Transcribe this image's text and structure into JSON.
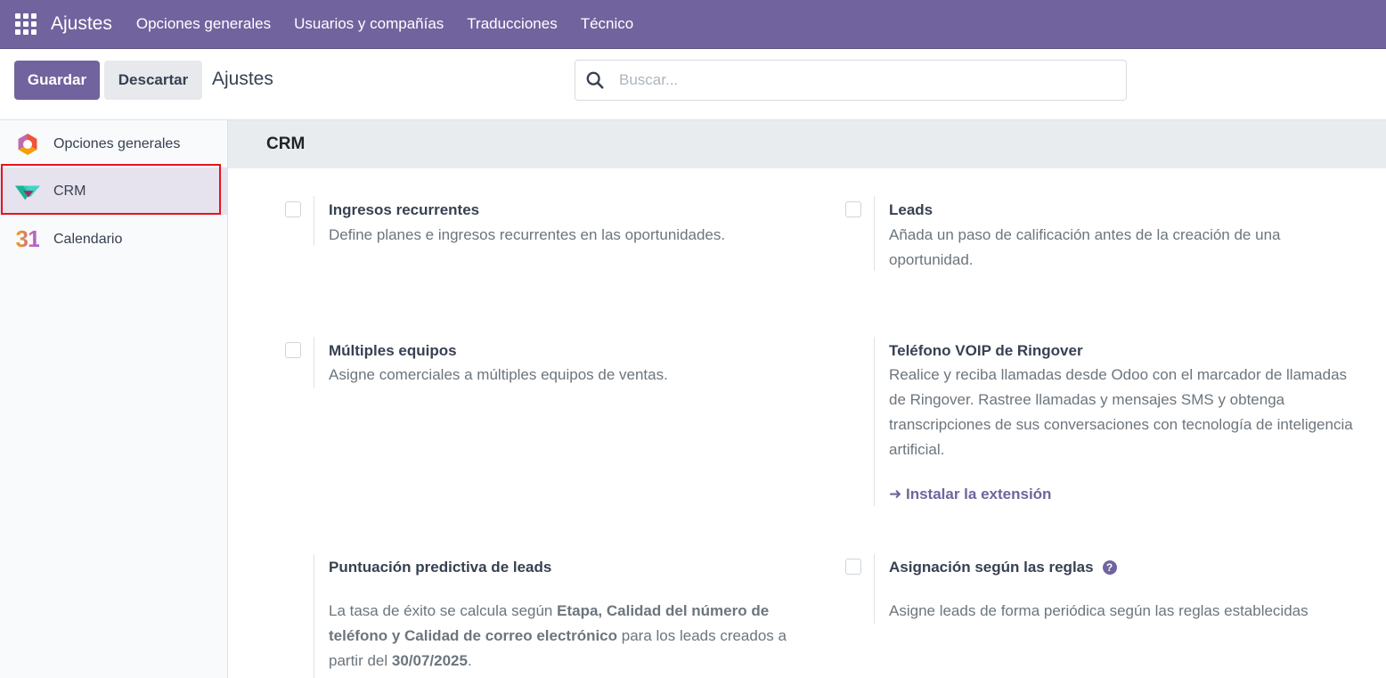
{
  "navbar": {
    "brand": "Ajustes",
    "menu": [
      "Opciones generales",
      "Usuarios y compañías",
      "Traducciones",
      "Técnico"
    ],
    "color": "#71639e"
  },
  "control_panel": {
    "save_label": "Guardar",
    "discard_label": "Descartar",
    "title": "Ajustes",
    "search_placeholder": "Buscar..."
  },
  "sidebar": {
    "items": [
      {
        "label": "Opciones generales",
        "icon": "general-settings-icon"
      },
      {
        "label": "CRM",
        "icon": "crm-icon",
        "active": true
      },
      {
        "label": "Calendario",
        "icon": "calendar-icon",
        "icon_text": "31"
      }
    ]
  },
  "section": {
    "title": "CRM",
    "settings": {
      "recurring": {
        "title": "Ingresos recurrentes",
        "desc": "Define planes e ingresos recurrentes en las oportunidades."
      },
      "leads": {
        "title": "Leads",
        "desc": "Añada un paso de calificación antes de la creación de una oportunidad."
      },
      "teams": {
        "title": "Múltiples equipos",
        "desc": "Asigne comerciales a múltiples equipos de ventas."
      },
      "ringover": {
        "title": "Teléfono VOIP de Ringover",
        "desc": "Realice y reciba llamadas desde Odoo con el marcador de llamadas de Ringover. Rastree llamadas y mensajes SMS y obtenga transcripciones de sus conversaciones con tecnología de inteligencia artificial.",
        "link": "Instalar la extensión"
      },
      "scoring": {
        "title": "Puntuación predictiva de leads",
        "desc_1": "La tasa de éxito se calcula según ",
        "desc_bold_1": "Etapa, Calidad del número de teléfono y Calidad de correo electrónico",
        "desc_2": " para los leads creados a partir del ",
        "desc_bold_2": "30/07/2025",
        "desc_3": "."
      },
      "rules": {
        "title": "Asignación según las reglas",
        "desc": "Asigne leads de forma periódica según las reglas establecidas"
      }
    }
  }
}
